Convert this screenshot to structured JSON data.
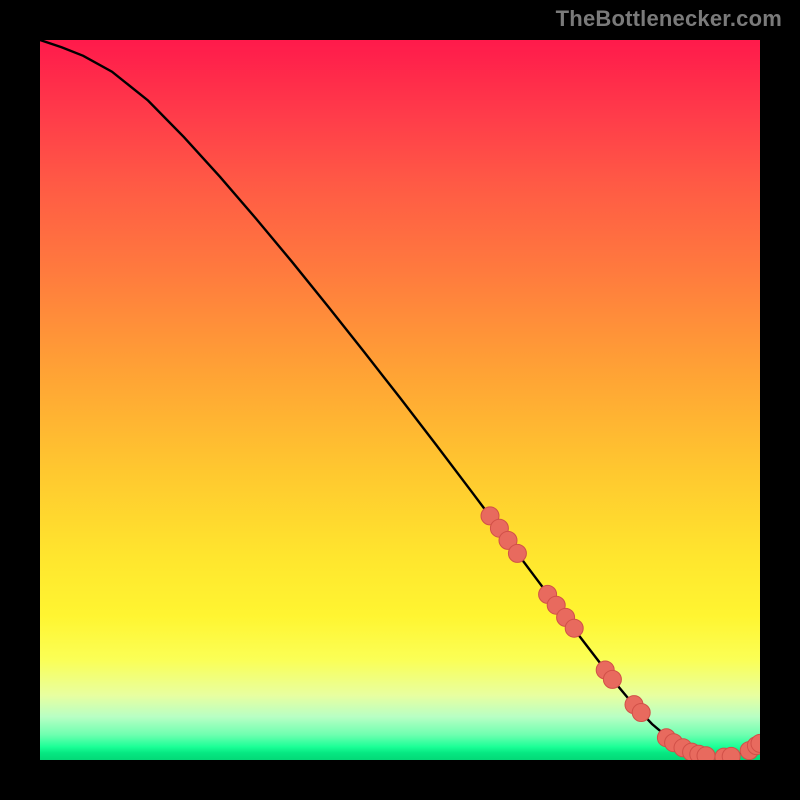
{
  "attribution": "TheBottlenecker.com",
  "colors": {
    "top": "#ff1a4b",
    "mid": "#ffe62e",
    "bottom": "#03d877",
    "curve": "#000000",
    "marker_fill": "#e86a5e",
    "marker_stroke": "#d15048"
  },
  "chart_data": {
    "type": "line",
    "title": "",
    "xlabel": "",
    "ylabel": "",
    "xlim": [
      0,
      100
    ],
    "ylim": [
      0,
      100
    ],
    "grid": false,
    "legend": false,
    "series": [
      {
        "name": "bottleneck-curve",
        "x": [
          0,
          3,
          6,
          10,
          15,
          20,
          25,
          30,
          35,
          40,
          45,
          50,
          55,
          60,
          63,
          66,
          69,
          72,
          75,
          78,
          80,
          82,
          85,
          87,
          89,
          91,
          93,
          95,
          97,
          99,
          100
        ],
        "y": [
          100,
          99,
          97.8,
          95.6,
          91.6,
          86.5,
          81,
          75.2,
          69.2,
          63,
          56.7,
          50.3,
          43.8,
          37.2,
          33.2,
          29.1,
          25.1,
          21.1,
          17.1,
          13.2,
          10.6,
          8.2,
          5.0,
          3.3,
          2.0,
          1.0,
          0.5,
          0.4,
          0.8,
          1.6,
          2.3
        ]
      }
    ],
    "markers": {
      "name": "highlighted-points",
      "points": [
        {
          "x": 62.5,
          "y": 33.9
        },
        {
          "x": 63.8,
          "y": 32.2
        },
        {
          "x": 65.0,
          "y": 30.5
        },
        {
          "x": 66.3,
          "y": 28.7
        },
        {
          "x": 70.5,
          "y": 23.0
        },
        {
          "x": 71.7,
          "y": 21.5
        },
        {
          "x": 73.0,
          "y": 19.8
        },
        {
          "x": 74.2,
          "y": 18.3
        },
        {
          "x": 78.5,
          "y": 12.5
        },
        {
          "x": 79.5,
          "y": 11.2
        },
        {
          "x": 82.5,
          "y": 7.7
        },
        {
          "x": 83.5,
          "y": 6.6
        },
        {
          "x": 87.0,
          "y": 3.1
        },
        {
          "x": 88.0,
          "y": 2.4
        },
        {
          "x": 89.3,
          "y": 1.7
        },
        {
          "x": 90.5,
          "y": 1.1
        },
        {
          "x": 91.5,
          "y": 0.8
        },
        {
          "x": 92.5,
          "y": 0.6
        },
        {
          "x": 95.0,
          "y": 0.4
        },
        {
          "x": 96.0,
          "y": 0.5
        },
        {
          "x": 98.5,
          "y": 1.3
        },
        {
          "x": 99.5,
          "y": 2.0
        },
        {
          "x": 100.0,
          "y": 2.3
        }
      ]
    }
  }
}
